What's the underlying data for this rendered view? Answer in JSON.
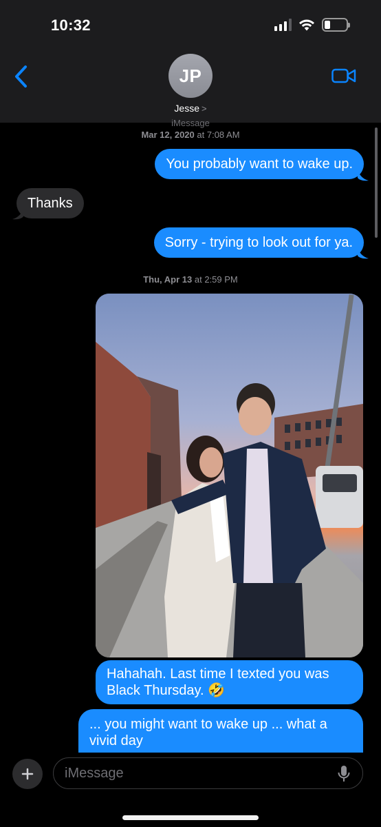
{
  "status_bar": {
    "time": "10:32",
    "icons": [
      "cellular-signal-icon",
      "wifi-icon",
      "battery-icon"
    ]
  },
  "header": {
    "back_icon": "chevron-left-icon",
    "avatar_initials": "JP",
    "contact_name": "Jesse",
    "contact_chevron": ">",
    "video_icon": "video-camera-icon"
  },
  "thread": {
    "service_label": "iMessage",
    "timestamp_1": {
      "date": "Mar 12, 2020",
      "time": "at 7:08 AM"
    },
    "messages_1": [
      {
        "direction": "outgoing",
        "text": "You probably want to wake up."
      },
      {
        "direction": "incoming",
        "text": "Thanks"
      },
      {
        "direction": "outgoing",
        "text": "Sorry - trying to look out for ya."
      }
    ],
    "timestamp_2": {
      "date": "Thu, Apr 13",
      "time": "at 2:59 PM"
    },
    "photo": {
      "kind": "photo-attachment"
    },
    "messages_2": [
      {
        "direction": "outgoing",
        "text": "Hahahah. Last time I texted you was Black Thursday. 🤣"
      },
      {
        "direction": "outgoing",
        "text": "... you might want to wake up ... what a vivid day"
      }
    ]
  },
  "composer": {
    "plus_icon": "plus-icon",
    "placeholder": "iMessage",
    "value": "",
    "mic_icon": "microphone-icon"
  },
  "colors": {
    "outgoing_bubble": "#1a8cff",
    "incoming_bubble": "#2c2c2e",
    "accent": "#0a84ff",
    "background": "#000000",
    "header_background": "#1c1c1e"
  }
}
